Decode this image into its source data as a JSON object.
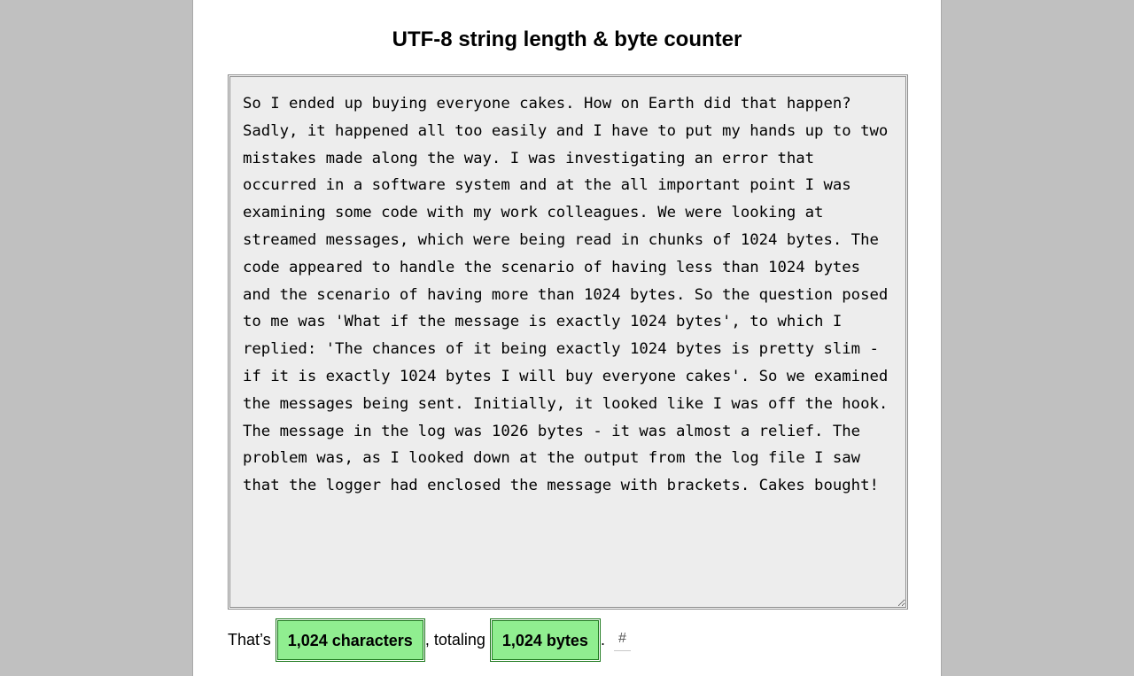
{
  "title": "UTF-8 string length & byte counter",
  "input": {
    "value": "So I ended up buying everyone cakes. How on Earth did that happen? Sadly, it happened all too easily and I have to put my hands up to two mistakes made along the way. I was investigating an error that occurred in a software system and at the all important point I was examining some code with my work colleagues. We were looking at streamed messages, which were being read in chunks of 1024 bytes. The code appeared to handle the scenario of having less than 1024 bytes and the scenario of having more than 1024 bytes. So the question posed to me was 'What if the message is exactly 1024 bytes', to which I replied: 'The chances of it being exactly 1024 bytes is pretty slim - if it is exactly 1024 bytes I will buy everyone cakes'. So we examined the messages being sent. Initially, it looked like I was off the hook. The message in the log was 1026 bytes - it was almost a relief. The problem was, as I looked down at the output from the log file I saw that the logger had enclosed the message with brackets. Cakes bought!"
  },
  "summary": {
    "prefix": "That’s ",
    "characters": "1,024 characters",
    "middle": ", totaling ",
    "bytes": "1,024 bytes",
    "suffix": ".",
    "permalink": "#"
  },
  "colors": {
    "background": "#c0c0c0",
    "highlight": "#90ee90",
    "highlight_border": "#1f7a1f",
    "textarea_bg": "#ededed"
  }
}
